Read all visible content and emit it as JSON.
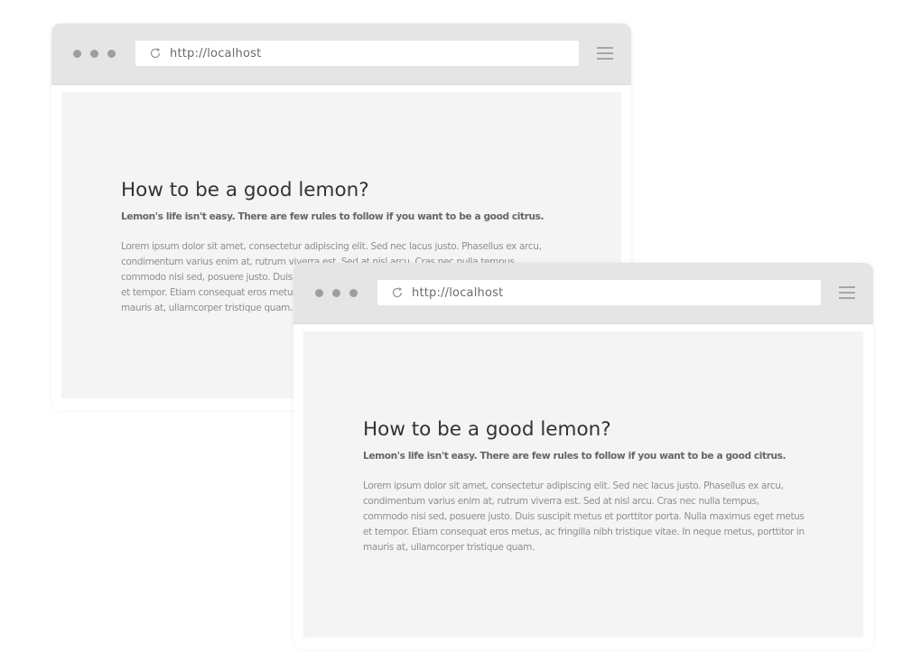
{
  "windows": [
    {
      "address_url": "http://localhost",
      "article": {
        "title": "How to be a good lemon?",
        "subtitle": "Lemon's life isn't easy. There are few rules to follow if you want to be a good citrus.",
        "body": "Lorem ipsum dolor sit amet, consectetur adipiscing elit. Sed nec lacus justo. Phasellus ex arcu, condimentum varius enim at, rutrum viverra est. Sed at nisl arcu. Cras nec nulla tempus, commodo nisi sed, posuere justo. Duis suscipit metus et porttitor porta. Nulla maximus eget metus et tempor. Etiam consequat eros metus, ac fringilla nibh tristique vitae. In neque metus, porttitor in mauris at, ullamcorper tristique quam."
      }
    },
    {
      "address_url": "http://localhost",
      "article": {
        "title": "How to be a good lemon?",
        "subtitle": "Lemon's life isn't easy. There are few rules to follow if you want to be a good citrus.",
        "body": "Lorem ipsum dolor sit amet, consectetur adipiscing elit. Sed nec lacus justo. Phasellus ex arcu, condimentum varius enim at, rutrum viverra est. Sed at nisl arcu. Cras nec nulla tempus, commodo nisi sed, posuere justo. Duis suscipit metus et porttitor porta. Nulla maximus eget metus et tempor. Etiam consequat eros metus, ac fringilla nibh tristique vitae. In neque metus, porttitor in mauris at, ullamcorper tristique quam."
      }
    }
  ],
  "icons": {
    "window_controls": "three-dots-icon",
    "reload": "reload-icon",
    "menu": "hamburger-menu-icon"
  },
  "colors": {
    "titlebar": "#e5e5e5",
    "viewport": "#f4f4f4",
    "dots": "#9e9e9e",
    "heading": "#333333",
    "body_text": "#8f8f8f"
  }
}
